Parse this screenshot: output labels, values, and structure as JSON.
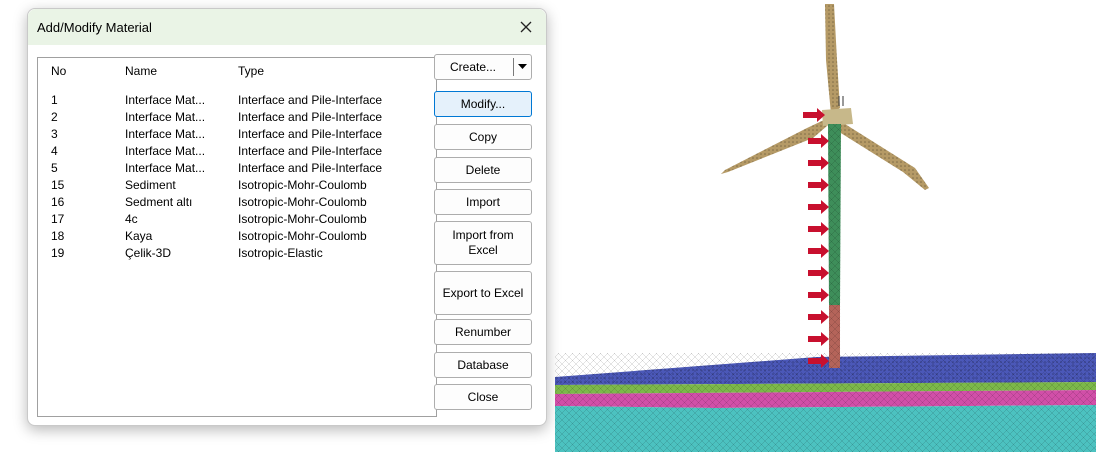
{
  "dialog": {
    "title": "Add/Modify Material",
    "close_icon": "close-icon"
  },
  "table": {
    "headers": {
      "no": "No",
      "name": "Name",
      "type": "Type"
    },
    "rows": [
      {
        "no": "1",
        "name": "Interface Mat...",
        "type": "Interface and Pile-Interface"
      },
      {
        "no": "2",
        "name": "Interface Mat...",
        "type": "Interface and Pile-Interface"
      },
      {
        "no": "3",
        "name": "Interface Mat...",
        "type": "Interface and Pile-Interface"
      },
      {
        "no": "4",
        "name": "Interface Mat...",
        "type": "Interface and Pile-Interface"
      },
      {
        "no": "5",
        "name": "Interface Mat...",
        "type": "Interface and Pile-Interface"
      },
      {
        "no": "15",
        "name": "Sediment",
        "type": "Isotropic-Mohr-Coulomb"
      },
      {
        "no": "16",
        "name": "Sedment altı",
        "type": "Isotropic-Mohr-Coulomb"
      },
      {
        "no": "17",
        "name": "4c",
        "type": "Isotropic-Mohr-Coulomb"
      },
      {
        "no": "18",
        "name": "Kaya",
        "type": "Isotropic-Mohr-Coulomb"
      },
      {
        "no": "19",
        "name": "Çelik-3D",
        "type": "Isotropic-Elastic"
      }
    ]
  },
  "buttons": {
    "create": "Create...",
    "create_dropdown_icon": "dropdown-arrow-icon",
    "modify": "Modify...",
    "copy": "Copy",
    "delete": "Delete",
    "import": "Import",
    "import_excel_line1": "Import from",
    "import_excel_line2": "Excel",
    "export_excel": "Export to Excel",
    "renumber": "Renumber",
    "database": "Database",
    "close": "Close"
  },
  "colors": {
    "titlebar": "#eaf4e6",
    "default_button_border": "#0078d4",
    "load_arrow": "#c8102e",
    "tower_green": "#3e8e5a",
    "tower_brown": "#b4645a",
    "blade": "#b59a66",
    "soil_blue": "#4b58b8",
    "soil_green": "#7cb84a",
    "soil_magenta": "#d14fa8",
    "soil_cyan": "#4cc2c0"
  }
}
